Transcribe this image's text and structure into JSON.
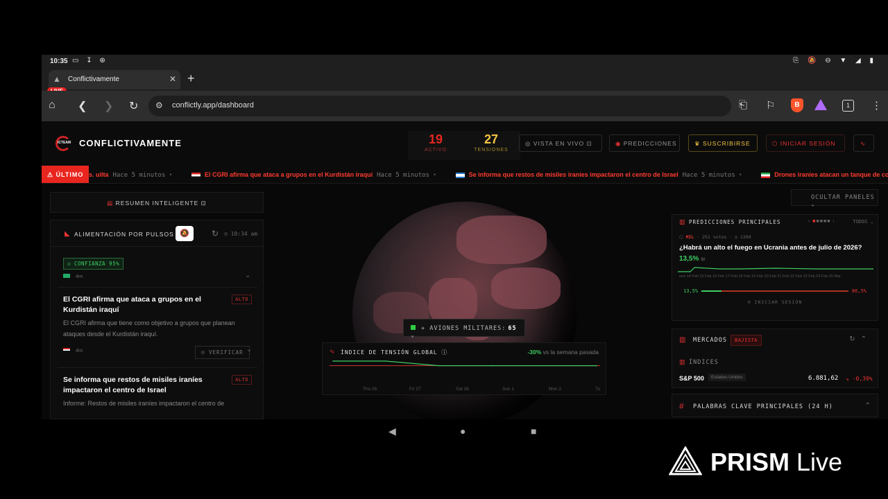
{
  "statusbar": {
    "time": "10:35",
    "left_icons": "▭ ↧ ⊛",
    "right_icons": "⎘ 🔕 ⊖ ▼ ◢ ▮"
  },
  "browser": {
    "tab_title": "Conflictivamente",
    "live_badge": "LIVE",
    "url": "conflictly.app/dashboard",
    "tab_count": "1"
  },
  "header": {
    "brand": "CONFLICTIVAMENTE",
    "logo_text": "ICTEAM",
    "active_count": "19",
    "active_label": "ACTIVO",
    "tensions_count": "27",
    "tensions_label": "TENSIONES",
    "live_view": "VISTA EN VIVO",
    "predictions": "PREDICCIONES",
    "subscribe": "SUSCRIBIRSE",
    "login": "INICIAR SESIÓN",
    "colors": {
      "accent": "#e8261f",
      "amber": "#f5c542",
      "green": "#3fce63"
    }
  },
  "ticker": {
    "label": "ÚLTIMO",
    "items": [
      {
        "headline": "s. uilta",
        "time": "Hace 5 minutos"
      },
      {
        "headline": "El CGRI afirma que ataca a grupos en el Kurdistán iraquí",
        "time": "Hace 5 minutos"
      },
      {
        "headline": "Se informa que restos de misiles iraníes impactaron el centro de Israel",
        "time": "Hace 5 minutos"
      },
      {
        "headline": "Drones iraníes atacan un tanque de co",
        "time": ""
      }
    ]
  },
  "left": {
    "summary": "RESUMEN INTELIGENTE",
    "feed_title": "ALIMENTACIÓN POR PULSOS",
    "feed_time": "10:34 am",
    "confidence": "CONFIANZA 95%",
    "first_meta": "4m",
    "news": [
      {
        "title": "El CGRI afirma que ataca a grupos en el Kurdistán iraquí",
        "severity": "ALTO",
        "desc": "El CGRI afirma que tiene como objetivo a grupos que planean ataques desde el Kurdistán iraquí.",
        "meta": "4m",
        "verify": "VERIFICAR"
      },
      {
        "title": "Se informa que restos de misiles iraníes impactaron el centro de Israel",
        "severity": "ALTO",
        "desc": "Informe: Restos de misiles iraníes impactaron el centro de"
      }
    ]
  },
  "center": {
    "aircraft_label": "AVIONES MILITARES:",
    "aircraft_count": "65",
    "tension_title": "ÍNDICE DE TENSIÓN GLOBAL",
    "tension_change": "-30%",
    "tension_suffix": "vs la semana pasada",
    "tension_days": [
      "Thu 26",
      "Fri 27",
      "Sat 28",
      "Sun 1",
      "Mon 2",
      "Tue"
    ]
  },
  "chart_data": {
    "type": "line",
    "categories": [
      "Thu 26",
      "Fri 27",
      "Sat 28",
      "Sun 1",
      "Mon 2",
      "Tue"
    ],
    "series": [
      {
        "values": [
          100,
          100,
          70,
          70,
          70,
          70
        ]
      }
    ]
  },
  "right": {
    "hide_panels": "OCULTAR PANELES",
    "pred_title": "PREDICCIONES PRINCIPALES",
    "pred_all": "TODOS",
    "pred_source": "MIL",
    "pred_votes": "251 votos",
    "pred_period": "120d",
    "pred_question": "¿Habrá un alto el fuego en Ucrania antes de julio de 2026?",
    "pred_pct": "13,5%",
    "pred_pct_suffix": "Sí",
    "pred_dates": "ene 14  Feb 15  Feb 16  Feb 17  Feb 18  Feb 19  Feb 20  Feb 21  Feb 22  Feb 23  Feb 24  Feb 25  Mar",
    "pred_yes": "13,5%",
    "pred_no": "86,5%",
    "pred_yes_fraction": 0.135,
    "pred_login": "INICIAR SESIÓN",
    "markets_title": "MERCADOS",
    "markets_badge": "BAJISTA",
    "indices_label": "ÍNDICES",
    "index_name": "S&P 500",
    "index_region": "Estados Unidos",
    "index_value": "6.881,62",
    "index_change": "-0,39%",
    "keywords_title": "PALABRAS CLAVE PRINCIPALES (24 H)"
  },
  "prism": {
    "brand": "PRISM",
    "suffix": "Live"
  }
}
